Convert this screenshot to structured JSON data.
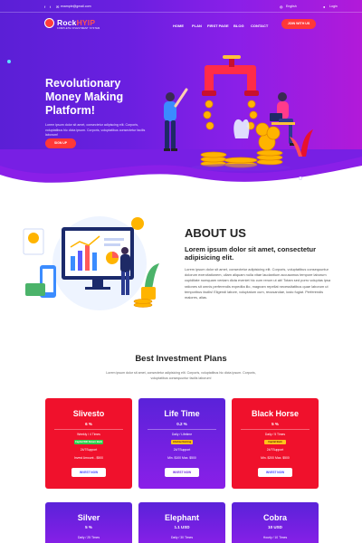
{
  "topbar": {
    "email": "example@gmail.com",
    "language": "English",
    "login": "Login"
  },
  "brand": {
    "name_a": "Rock",
    "name_b": "HYIP",
    "tagline": "COMPLETE INVESTMENT SYSTEM"
  },
  "nav": {
    "items": [
      "HOME",
      "PLAN",
      "FIRST PAGE",
      "BLOG",
      "CONTACT"
    ],
    "cta": "JOIN WITH US"
  },
  "hero": {
    "title": "Revolutionary Money Making Platform!",
    "text": "Lorem ipsum dolor sit amet, consectetur adipiscing elit. Corporis, voluptatibus hic dicta ipsum. Corporis, voluptatibus consectetur facilis laborum!",
    "button": "SIGN UP"
  },
  "about": {
    "title": "ABOUT US",
    "subtitle": "Lorem ipsum dolor sit amet, consectetur adipisicing elit.",
    "text": "Lorem ipsum dolor sit amet, consectetur adipisicing elit. Corporis, voluptatibus consequuntur dolorum exercitationem, ullam aliquam nulla vitae laudantium accusamus tempore laborum cupiditate numquam veniam dicta eveniet hic cum rerum ut ab! Totam sed porro voluptas ipsa rationes sit omnis perferendis expedita illo, magnam repellat necessitatibus quae laborum ut temporibus facilis! Eligendi labore, voluptatum cum, recusandae, iusto fugiat. Perferendis maiores, alias."
  },
  "plans": {
    "title": "Best Investment Plans",
    "text": "Lorem ipsum dolor sit amet, consectetur adipisicing elit. Corporis, voluptatibus hic dicta ipsum. Corporis, voluptatibus consequuntur facilis laborum!",
    "cards": [
      {
        "name": "Slivesto",
        "rate": "6 %",
        "term": "Weekly / 4 Times",
        "badge": "Capital Will Return Back",
        "support": "24/7Support",
        "amount": "Invest Amount - $500",
        "button": "INVEST NOW",
        "style": "red"
      },
      {
        "name": "Life Time",
        "rate": "0.2 %",
        "term": "Daily / Lifetime",
        "badge": "Lifetime Earning",
        "support": "24/7Support",
        "amount": "Min. $100 Max. $500",
        "button": "INVEST NOW",
        "style": "blue"
      },
      {
        "name": "Black Horse",
        "rate": "5 %",
        "term": "Daily / 5 Times",
        "badge": "Capital Back",
        "support": "24/7Support",
        "amount": "Min. $200 Max. $500",
        "button": "INVEST NOW",
        "style": "red"
      }
    ],
    "cards_row2": [
      {
        "name": "Silver",
        "rate": "5 %",
        "term": "Daily / 25 Times",
        "style": "blue"
      },
      {
        "name": "Elephant",
        "rate": "1.1 USD",
        "term": "Daily / 30 Times",
        "style": "blue"
      },
      {
        "name": "Cobra",
        "rate": "10 USD",
        "term": "Hourly / 10 Times",
        "style": "blue"
      }
    ]
  },
  "colors": {
    "accent_red": "#f0112c",
    "primary_purple": "#6a1fe0",
    "magenta": "#b21ad9"
  }
}
